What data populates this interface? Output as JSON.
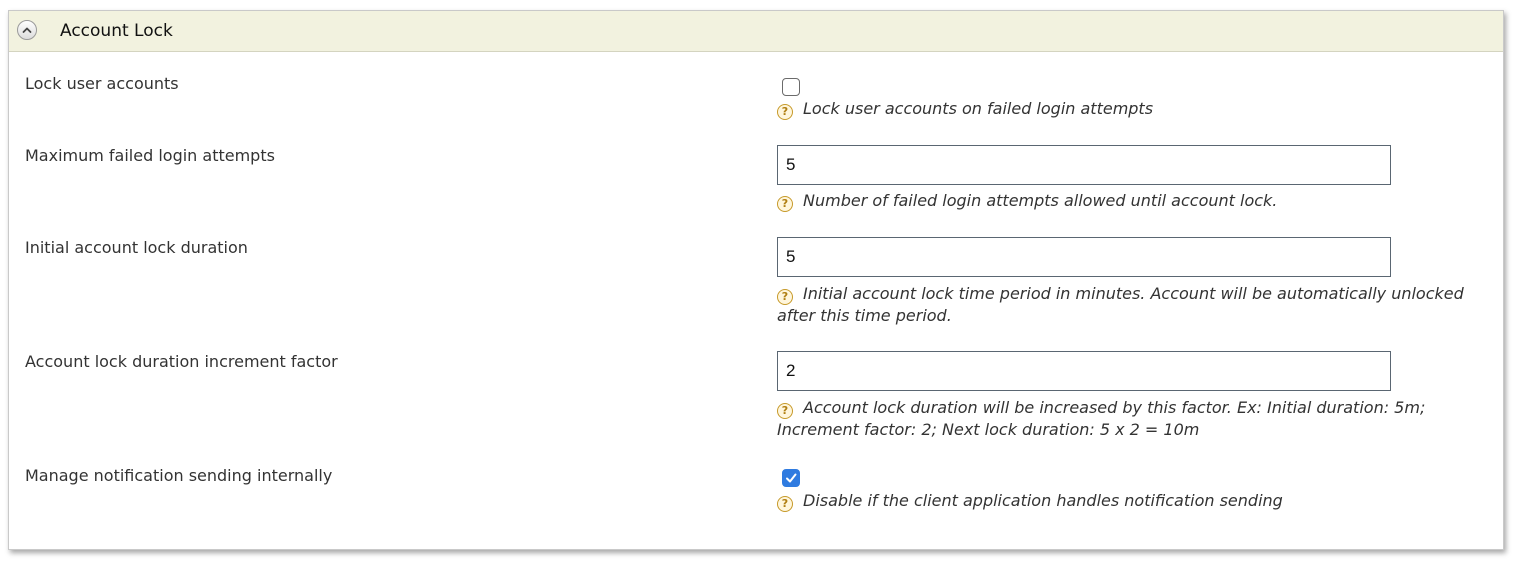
{
  "panel": {
    "title": "Account Lock",
    "collapse_icon": "chevron-up-icon"
  },
  "settings": [
    {
      "label": "Lock user accounts",
      "control": "checkbox",
      "checked": false,
      "help": "Lock user accounts on failed login attempts"
    },
    {
      "label": "Maximum failed login attempts",
      "control": "text",
      "value": "5",
      "help": "Number of failed login attempts allowed until account lock."
    },
    {
      "label": "Initial account lock duration",
      "control": "text",
      "value": "5",
      "help": "Initial account lock time period in minutes. Account will be automatically unlocked after this time period."
    },
    {
      "label": "Account lock duration increment factor",
      "control": "text",
      "value": "2",
      "help": "Account lock duration will be increased by this factor. Ex: Initial duration: 5m; Increment factor: 2; Next lock duration: 5 x 2 = 10m"
    },
    {
      "label": "Manage notification sending internally",
      "control": "checkbox",
      "checked": true,
      "help": "Disable if the client application handles notification sending"
    }
  ],
  "help_icon": "question-mark-icon",
  "help_icon_glyph": "?",
  "colors": {
    "header_bg": "#f2f2df",
    "checkbox_checked": "#2f7be0",
    "help_icon": "#c79a2a"
  }
}
